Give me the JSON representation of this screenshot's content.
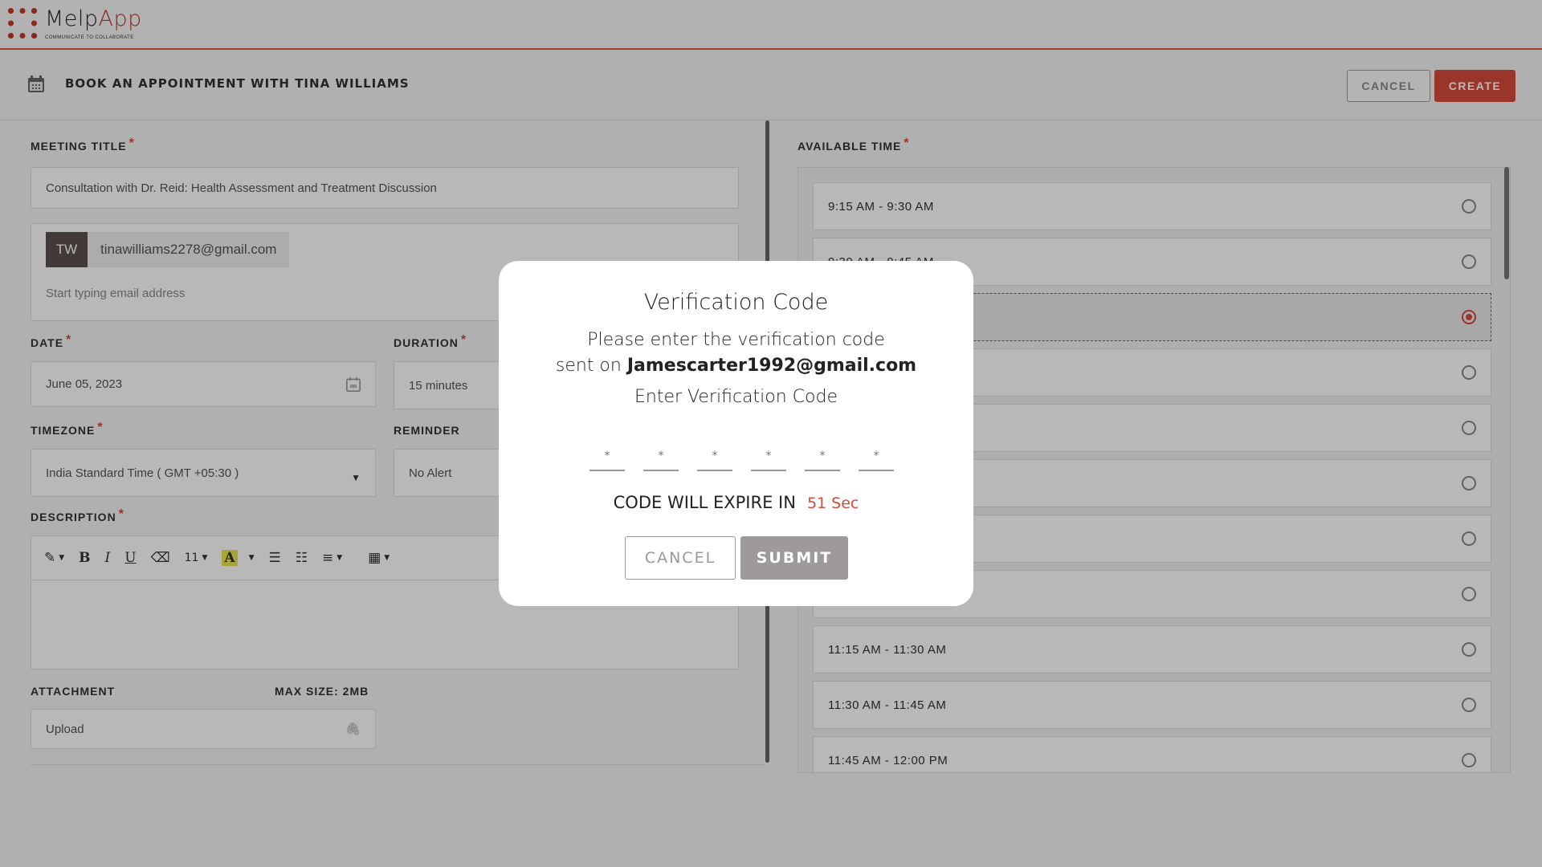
{
  "header": {
    "brand_primary": "Melp",
    "brand_accent": "App",
    "tagline": "COMMUNICATE TO COLLABORATE",
    "accent_color": "#d44a3a"
  },
  "subheader": {
    "icon": "calendar-icon",
    "title": "BOOK AN APPOINTMENT WITH TINA WILLIAMS",
    "cancel_label": "CANCEL",
    "create_label": "CREATE"
  },
  "form": {
    "meeting_title": {
      "label": "MEETING TITLE",
      "required": "*",
      "value": "Consultation with Dr. Reid: Health Assessment and Treatment Discussion"
    },
    "invitees": {
      "chips": [
        {
          "initials": "TW",
          "email": "tinawilliams2278@gmail.com"
        }
      ],
      "placeholder": "Start typing email address"
    },
    "date": {
      "label": "DATE",
      "required": "*",
      "value": "June 05, 2023",
      "icon": "calendar-icon"
    },
    "duration": {
      "label": "DURATION",
      "required": "*",
      "value": "15 minutes"
    },
    "timezone": {
      "label": "TIMEZONE",
      "required": "*",
      "value": "India Standard Time ( GMT +05:30 )",
      "icon": "caret-down-icon"
    },
    "reminder": {
      "label": "REMINDER",
      "value": "No Alert"
    },
    "description": {
      "label": "DESCRIPTION",
      "required": "*",
      "toolbar": {
        "magic": "✎",
        "bold": "B",
        "italic": "I",
        "underline": "U",
        "eraser": "⌫",
        "font_size": "11",
        "highlight": "A",
        "bullet_list": "☰",
        "numbered_list": "☷",
        "align": "≡",
        "table": "▦"
      },
      "value": ""
    },
    "attachment": {
      "label": "ATTACHMENT",
      "max_size": "MAX SIZE: 2MB",
      "upload_label": "Upload",
      "icon": "paperclip-icon"
    }
  },
  "available_time": {
    "label": "AVAILABLE TIME",
    "required": "*",
    "slots": [
      {
        "label": "9:15 AM - 9:30 AM",
        "selected": false
      },
      {
        "label": "9:30 AM - 9:45 AM",
        "selected": false
      },
      {
        "label": "",
        "selected": true
      },
      {
        "label": "",
        "selected": false
      },
      {
        "label": "",
        "selected": false
      },
      {
        "label": "",
        "selected": false
      },
      {
        "label": "",
        "selected": false
      },
      {
        "label": "",
        "selected": false
      },
      {
        "label": "11:15 AM - 11:30 AM",
        "selected": false
      },
      {
        "label": "11:30 AM - 11:45 AM",
        "selected": false
      },
      {
        "label": "11:45 AM - 12:00 PM",
        "selected": false
      }
    ]
  },
  "modal": {
    "title": "Verification Code",
    "line1": "Please enter the verification code",
    "line2_prefix": "sent on ",
    "email": "Jamescarter1992@gmail.com",
    "line3": "Enter Verification Code",
    "code_placeholders": [
      "*",
      "*",
      "*",
      "*",
      "*",
      "*"
    ],
    "expire_label": "CODE WILL EXPIRE IN",
    "expire_value": "51 Sec",
    "cancel_label": "CANCEL",
    "submit_label": "SUBMIT"
  }
}
